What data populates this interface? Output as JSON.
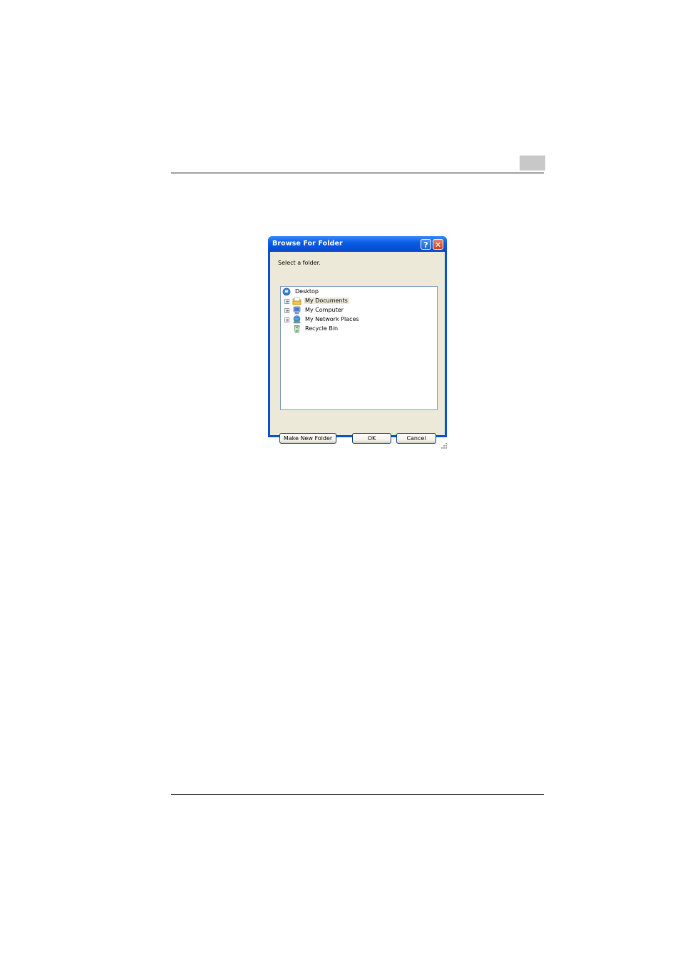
{
  "dialog": {
    "title": "Browse For Folder",
    "help_button": "?",
    "close_button": "✕",
    "prompt": "Select a folder."
  },
  "tree": {
    "root": {
      "label": "Desktop",
      "icon": "desktop-icon"
    },
    "items": [
      {
        "label": "My Documents",
        "icon": "my-documents-icon",
        "expandable": true,
        "selected": true
      },
      {
        "label": "My Computer",
        "icon": "my-computer-icon",
        "expandable": true
      },
      {
        "label": "My Network Places",
        "icon": "network-places-icon",
        "expandable": true
      },
      {
        "label": "Recycle Bin",
        "icon": "recycle-bin-icon",
        "expandable": false
      }
    ],
    "expand_glyph": "+"
  },
  "buttons": {
    "make_new_folder": "Make New Folder",
    "ok": "OK",
    "cancel": "Cancel"
  },
  "colors": {
    "titlebar": "#0550d6",
    "client_bg": "#ece9d8",
    "tree_border": "#7f9db9",
    "selection_bg": "#ece9d8"
  }
}
